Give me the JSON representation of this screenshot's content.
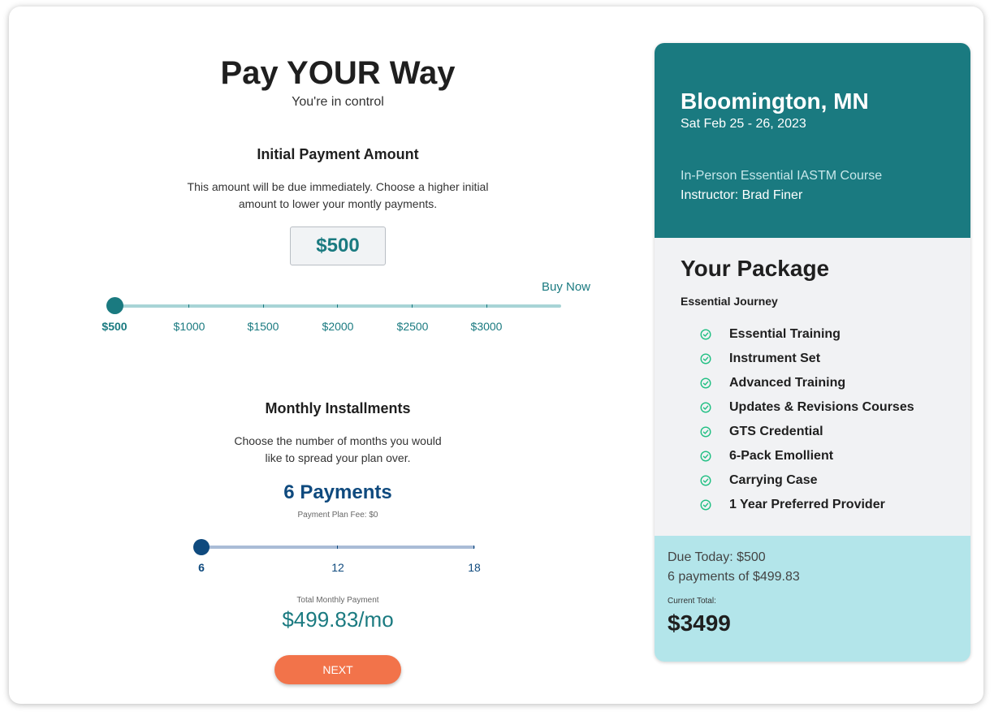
{
  "header": {
    "title": "Pay YOUR Way",
    "subtitle": "You're in control"
  },
  "initial_payment": {
    "heading": "Initial Payment Amount",
    "description_line1": "This amount will be due immediately. Choose a higher initial",
    "description_line2": "amount to lower your montly payments.",
    "amount": "$500",
    "buy_now": "Buy Now",
    "slider_labels": [
      "$500",
      "$1000",
      "$1500",
      "$2000",
      "$2500",
      "$3000"
    ],
    "selected_index": 0,
    "colors": {
      "accent": "#1a7a80",
      "track": "#a8d4d6"
    }
  },
  "installments": {
    "heading": "Monthly Installments",
    "description_line1": "Choose the number of months you would",
    "description_line2": "like to spread your plan over.",
    "payments": "6 Payments",
    "fee": "Payment Plan Fee: $0",
    "slider_labels": [
      "6",
      "12",
      "18"
    ],
    "selected_index": 0,
    "total_label": "Total Monthly Payment",
    "total_value": "$499.83/mo",
    "colors": {
      "accent": "#0f4a7e",
      "track": "#a9bcd6"
    }
  },
  "next_button": "NEXT",
  "summary": {
    "city": "Bloomington, MN",
    "dates": "Sat Feb 25 - 26, 2023",
    "course": "In-Person Essential IASTM Course",
    "instructor": "Instructor: Brad Finer",
    "package_title": "Your Package",
    "package_name": "Essential Journey",
    "items": [
      "Essential Training",
      "Instrument Set",
      "Advanced Training",
      "Updates & Revisions Courses",
      "GTS Credential",
      "6-Pack Emollient",
      "Carrying Case",
      "1 Year Preferred Provider"
    ],
    "item_icon": "check-circle-icon",
    "due_today": "Due Today: $500",
    "payments_summary": "6 payments of $499.83",
    "current_total_label": "Current Total:",
    "current_total": "$3499",
    "colors": {
      "header_bg": "#1a7a80",
      "footer_bg": "#b3e5ea",
      "check": "#1fbf82",
      "next_button": "#f2734a"
    }
  }
}
